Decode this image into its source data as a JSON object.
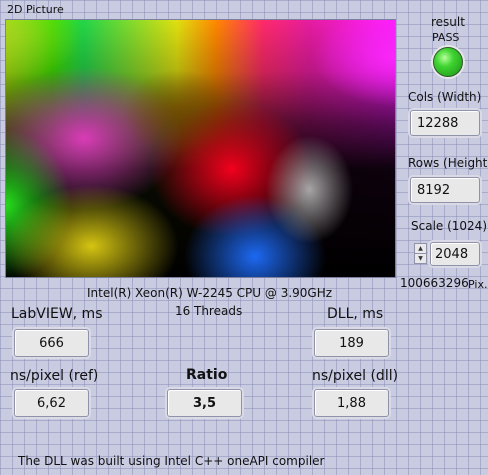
{
  "picture": {
    "label": "2D Picture"
  },
  "result": {
    "label": "result",
    "status": "PASS",
    "led_color": "#3fd431"
  },
  "cols": {
    "label": "Cols (Width)",
    "value": "12288"
  },
  "rows": {
    "label": "Rows (Height)",
    "value": "8192"
  },
  "scale": {
    "label": "Scale (1024)",
    "value": "2048"
  },
  "pixels": {
    "value": "100663296",
    "unit": "Pix."
  },
  "cpu": {
    "name": "Intel(R) Xeon(R) W-2245 CPU @ 3.90GHz",
    "threads": "16",
    "threads_label": "Threads"
  },
  "labview": {
    "label": "LabVIEW, ms",
    "value": "666"
  },
  "dll": {
    "label": "DLL, ms",
    "value": "189"
  },
  "ns_ref": {
    "label": "ns/pixel (ref)",
    "value": "6,62"
  },
  "ratio": {
    "label": "Ratio",
    "value": "3,5"
  },
  "ns_dll": {
    "label": "ns/pixel (dll)",
    "value": "1,88"
  },
  "footer": {
    "note": "The DLL was built using Intel C++ oneAPI compiler"
  },
  "icons": {
    "spin_up": "triangle-up",
    "spin_down": "triangle-down"
  }
}
